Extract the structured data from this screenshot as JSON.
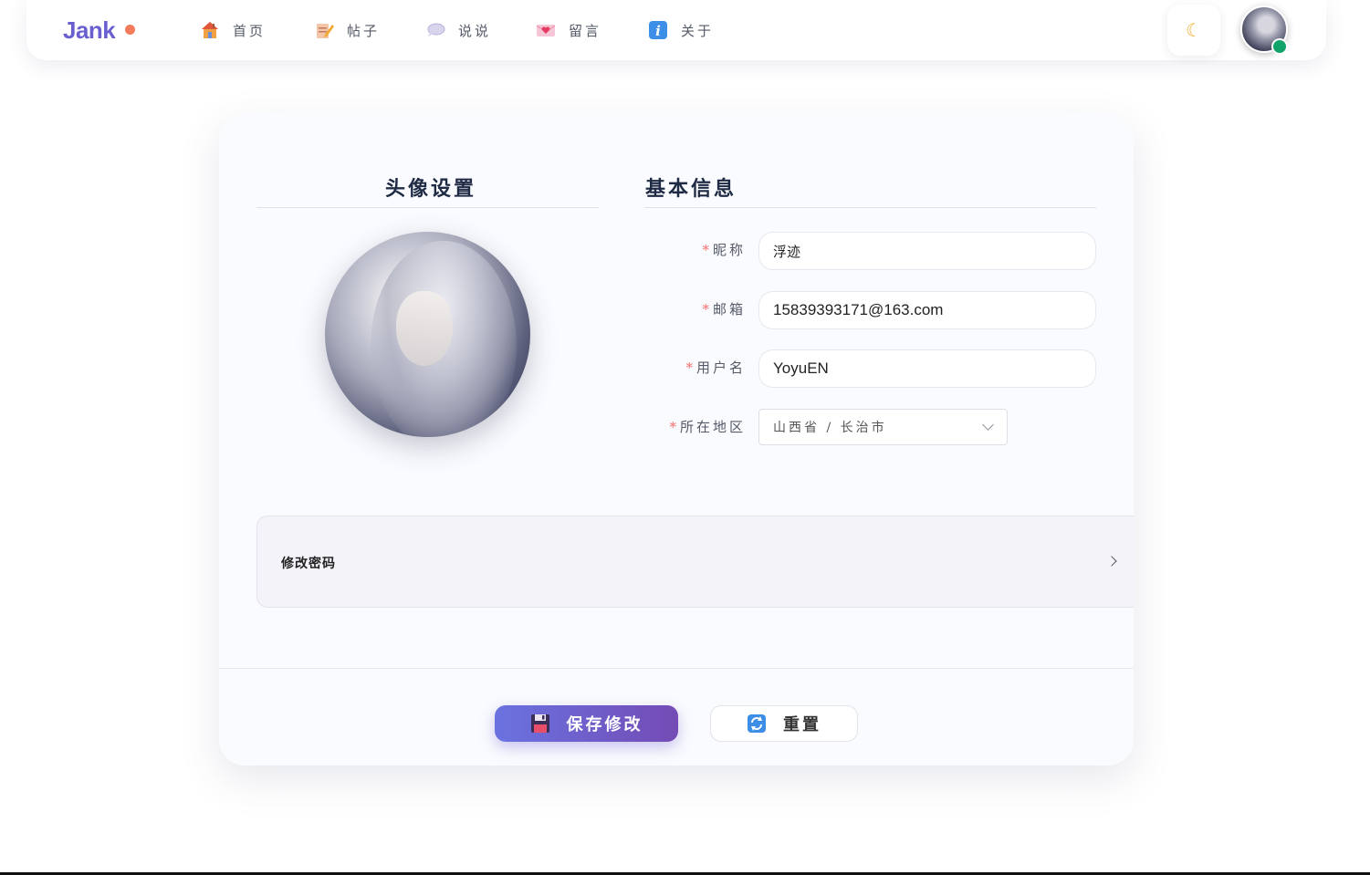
{
  "brand": {
    "name": "Jank"
  },
  "nav": {
    "items": [
      {
        "label": "首页",
        "icon": "house-icon"
      },
      {
        "label": "帖子",
        "icon": "memo-icon"
      },
      {
        "label": "说说",
        "icon": "speech-bubble-icon"
      },
      {
        "label": "留言",
        "icon": "love-letter-icon"
      },
      {
        "label": "关于",
        "icon": "info-icon"
      }
    ],
    "theme_icon": "☾"
  },
  "profile": {
    "avatar_title": "头像设置",
    "info_title": "基本信息",
    "required_mark": "*",
    "fields": {
      "nickname": {
        "label": "昵称",
        "value": "浮迹"
      },
      "email": {
        "label": "邮箱",
        "value": "15839393171@163.com"
      },
      "username": {
        "label": "用户名",
        "value": "YoyuEN"
      },
      "region": {
        "label": "所在地区",
        "value": "山西省 / 长治市"
      }
    },
    "change_password": {
      "label": "修改密码"
    }
  },
  "actions": {
    "save_label": "保存修改",
    "reset_label": "重置"
  },
  "colors": {
    "brand": "#6a5fd0",
    "brand_dot": "#f27b5c",
    "required": "#f56c6c",
    "online": "#12a36a",
    "save_gradient_start": "#6a73e0",
    "save_gradient_end": "#744bb5"
  }
}
